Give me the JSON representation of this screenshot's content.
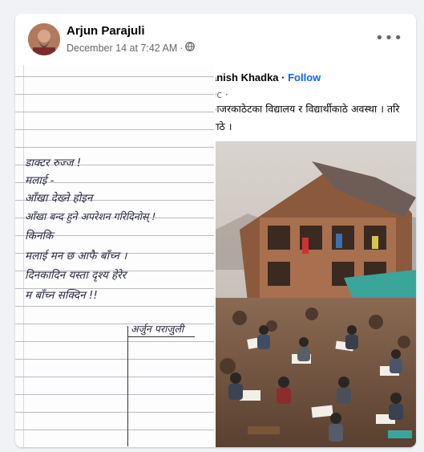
{
  "post": {
    "author": "Arjun Parajuli",
    "timestamp": "December 14 at 7:42 AM",
    "separator": "·",
    "privacy_icon": "globe-icon",
    "more_icon": "more-options-icon",
    "more_label": "•••"
  },
  "note": {
    "lines": [
      "डाक्टर रुज्ज !",
      "मलाई -",
      "आँखा देख्ने होइन",
      "आँखा बन्द हुने अपरेशन गरिदिनोस् !",
      "किनकि",
      "मलाई मन छ आफै बाँच्न ।",
      "दिनकादिन यस्ता दृश्य हेरेर",
      "म बाँच्न सक्दिन !!"
    ],
    "signature": "अर्जुन पराजुली"
  },
  "shared": {
    "name": "anish Khadka",
    "dot": " · ",
    "follow": "Follow",
    "meta": "ec ·",
    "text_line1": "ाजरकाठेटका विद्यालय र विद्यार्थीकाठे अवस्था । तरि",
    "text_line2": "याठे ।"
  },
  "colors": {
    "link": "#0866ff",
    "text": "#050505",
    "secondary": "#65676b",
    "ink": "#2a2a45"
  }
}
